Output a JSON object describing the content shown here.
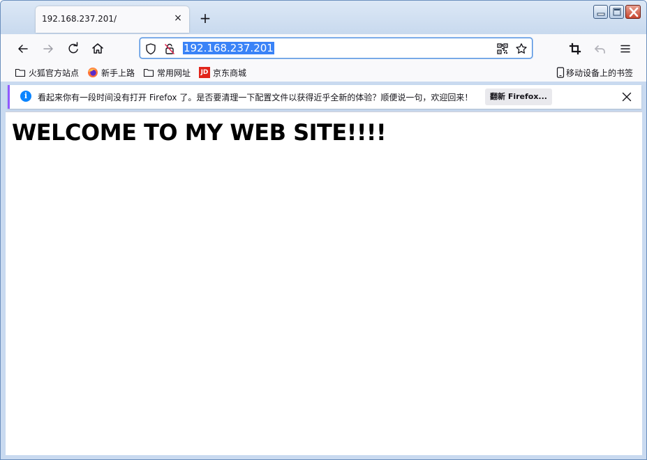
{
  "tab": {
    "title": "192.168.237.201/",
    "close_symbol": "×",
    "new_tab_symbol": "+"
  },
  "urlbar": {
    "url": "192.168.237.201"
  },
  "bookmarks": [
    {
      "label": "火狐官方站点",
      "icon": "folder-icon"
    },
    {
      "label": "新手上路",
      "icon": "firefox-icon"
    },
    {
      "label": "常用网址",
      "icon": "folder-icon"
    },
    {
      "label": "京东商城",
      "icon": "jd-icon",
      "icon_text": "JD"
    }
  ],
  "mobile_bookmarks": {
    "label": "移动设备上的书签"
  },
  "notification": {
    "message": "看起来你有一段时间没有打开 Firefox 了。是否要清理一下配置文件以获得近乎全新的体验？顺便说一句，欢迎回来！",
    "button_label": "翻新 Firefox...",
    "info_symbol": "i"
  },
  "page": {
    "heading": "WELCOME TO MY WEB SITE!!!!"
  },
  "colors": {
    "accent": "#3a83f7",
    "notification_accent": "#9059ff",
    "jd_red": "#e1251b"
  }
}
